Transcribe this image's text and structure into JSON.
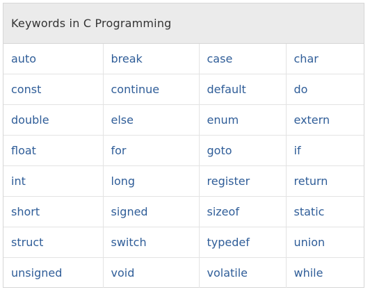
{
  "table": {
    "title": "Keywords in C Programming",
    "rows": [
      [
        "auto",
        "break",
        "case",
        "char"
      ],
      [
        "const",
        "continue",
        "default",
        "do"
      ],
      [
        "double",
        "else",
        "enum",
        "extern"
      ],
      [
        "float",
        "for",
        "goto",
        "if"
      ],
      [
        "int",
        "long",
        "register",
        "return"
      ],
      [
        "short",
        "signed",
        "sizeof",
        "static"
      ],
      [
        "struct",
        "switch",
        "typedef",
        "union"
      ],
      [
        "unsigned",
        "void",
        "volatile",
        "while"
      ]
    ]
  },
  "colors": {
    "keyword_text": "#2f5d98",
    "header_bg": "#ebebeb",
    "header_text": "#333333",
    "border": "#d6d6d6"
  }
}
